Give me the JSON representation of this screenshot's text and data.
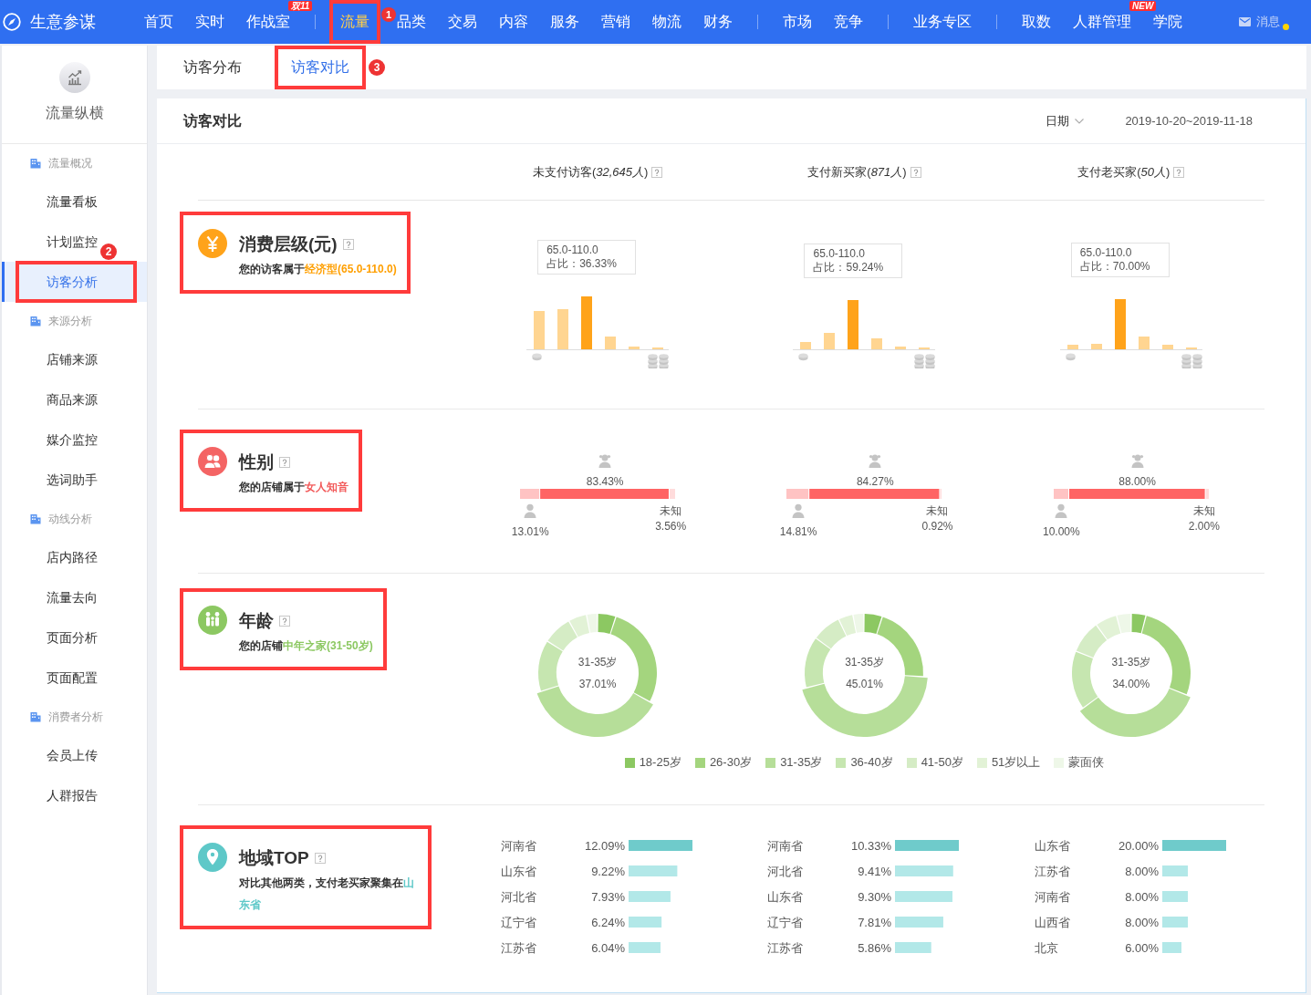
{
  "topnav": {
    "logo": "生意参谋",
    "groups": [
      {
        "items": [
          {
            "label": "首页",
            "selected": false,
            "annotated": false
          },
          {
            "label": "实时",
            "selected": false,
            "annotated": false
          },
          {
            "label": "作战室",
            "selected": false,
            "annotated": false,
            "tag": "双11"
          }
        ]
      },
      {
        "items": [
          {
            "label": "流量",
            "selected": true,
            "annotated": true,
            "badge": "1"
          },
          {
            "label": "品类",
            "selected": false,
            "annotated": false
          },
          {
            "label": "交易",
            "selected": false,
            "annotated": false
          },
          {
            "label": "内容",
            "selected": false,
            "annotated": false
          },
          {
            "label": "服务",
            "selected": false,
            "annotated": false
          },
          {
            "label": "营销",
            "selected": false,
            "annotated": false
          },
          {
            "label": "物流",
            "selected": false,
            "annotated": false
          },
          {
            "label": "财务",
            "selected": false,
            "annotated": false
          }
        ]
      },
      {
        "items": [
          {
            "label": "市场",
            "selected": false,
            "annotated": false
          },
          {
            "label": "竞争",
            "selected": false,
            "annotated": false
          }
        ]
      },
      {
        "items": [
          {
            "label": "业务专区",
            "selected": false,
            "annotated": false
          }
        ]
      },
      {
        "items": [
          {
            "label": "取数",
            "selected": false,
            "annotated": false
          },
          {
            "label": "人群管理",
            "selected": false,
            "annotated": false,
            "tag": "NEW"
          },
          {
            "label": "学院",
            "selected": false,
            "annotated": false
          }
        ]
      }
    ],
    "messages": {
      "label": "消息",
      "unread": true
    }
  },
  "sidebar": {
    "title": "流量纵横",
    "groups": [
      {
        "label": "流量概况",
        "items": [
          {
            "label": "流量看板",
            "selected": false,
            "annotated": false
          },
          {
            "label": "计划监控",
            "selected": false,
            "annotated": false
          },
          {
            "label": "访客分析",
            "selected": true,
            "annotated": true,
            "badge": "2"
          }
        ]
      },
      {
        "label": "来源分析",
        "items": [
          {
            "label": "店铺来源",
            "selected": false,
            "annotated": false
          },
          {
            "label": "商品来源",
            "selected": false,
            "annotated": false
          },
          {
            "label": "媒介监控",
            "selected": false,
            "annotated": false
          },
          {
            "label": "选词助手",
            "selected": false,
            "annotated": false
          }
        ]
      },
      {
        "label": "动线分析",
        "items": [
          {
            "label": "店内路径",
            "selected": false,
            "annotated": false
          },
          {
            "label": "流量去向",
            "selected": false,
            "annotated": false
          },
          {
            "label": "页面分析",
            "selected": false,
            "annotated": false
          },
          {
            "label": "页面配置",
            "selected": false,
            "annotated": false
          }
        ]
      },
      {
        "label": "消费者分析",
        "items": [
          {
            "label": "会员上传",
            "selected": false,
            "annotated": false
          },
          {
            "label": "人群报告",
            "selected": false,
            "annotated": false
          }
        ]
      }
    ]
  },
  "tabs": [
    {
      "label": "访客分布",
      "selected": false,
      "annotated": false
    },
    {
      "label": "访客对比",
      "selected": true,
      "annotated": true,
      "badge": "3"
    }
  ],
  "panel": {
    "title": "访客对比",
    "date_label": "日期",
    "date_range": "2019-10-20~2019-11-18",
    "columns": [
      "未支付访客(*32,645人*)",
      "支付新买家(*871人*)",
      "支付老买家(*50人*)"
    ],
    "sections": [
      {
        "kind": "spend",
        "title": "消费层级(元)",
        "summary": "您的访客属于",
        "highlight": "经济型(65.0-110.0)",
        "annotated": true,
        "charts": [
          {
            "tooltip_range": "65.0-110.0",
            "tooltip_share": "占比：36.33%"
          },
          {
            "tooltip_range": "65.0-110.0",
            "tooltip_share": "占比：59.24%"
          },
          {
            "tooltip_range": "65.0-110.0",
            "tooltip_share": "占比：70.00%"
          }
        ]
      },
      {
        "kind": "gender",
        "title": "性别",
        "summary": "您的店铺属于",
        "highlight": "女人知音",
        "annotated": true,
        "charts": [
          {
            "female_share": "83.43%",
            "male_share": "13.01%",
            "unknown_label": "未知",
            "unknown_share": "3.56%"
          },
          {
            "female_share": "84.27%",
            "male_share": "14.81%",
            "unknown_label": "未知",
            "unknown_share": "0.92%"
          },
          {
            "female_share": "88.00%",
            "male_share": "10.00%",
            "unknown_label": "未知",
            "unknown_share": "2.00%"
          }
        ]
      },
      {
        "kind": "age",
        "title": "年龄",
        "summary": "您的店铺",
        "highlight": "中年之家(31-50岁)",
        "annotated": true,
        "charts": [
          {
            "center_label": "31-35岁",
            "center_value": "37.01%"
          },
          {
            "center_label": "31-35岁",
            "center_value": "45.01%"
          },
          {
            "center_label": "31-35岁",
            "center_value": "34.00%"
          }
        ],
        "legend": [
          {
            "label": "18-25岁",
            "color": "#8cc862"
          },
          {
            "label": "26-30岁",
            "color": "#a4d57e"
          },
          {
            "label": "31-35岁",
            "color": "#b6de99"
          },
          {
            "label": "36-40岁",
            "color": "#c6e6b0"
          },
          {
            "label": "41-50岁",
            "color": "#d5ecc5"
          },
          {
            "label": "51岁以上",
            "color": "#e2f2d6"
          },
          {
            "label": "蒙面侠",
            "color": "#eef7e8"
          }
        ]
      },
      {
        "kind": "region",
        "title": "地域TOP",
        "summary": "对比其他两类，支付老买家聚集在",
        "highlight": "山东省",
        "annotated": true,
        "charts": [
          {
            "chart_data": {
              "type": "bar",
              "orientation": "horizontal",
              "categories": [
                "河南省",
                "山东省",
                "河北省",
                "辽宁省",
                "江苏省"
              ],
              "values": [
                12.09,
                9.22,
                7.93,
                6.24,
                6.04
              ],
              "value_labels": [
                "12.09%",
                "9.22%",
                "7.93%",
                "6.24%",
                "6.04%"
              ]
            }
          },
          {
            "chart_data": {
              "type": "bar",
              "orientation": "horizontal",
              "categories": [
                "河南省",
                "河北省",
                "山东省",
                "辽宁省",
                "江苏省"
              ],
              "values": [
                10.33,
                9.41,
                9.3,
                7.81,
                5.86
              ],
              "value_labels": [
                "10.33%",
                "9.41%",
                "9.30%",
                "7.81%",
                "5.86%"
              ]
            }
          },
          {
            "chart_data": {
              "type": "bar",
              "orientation": "horizontal",
              "categories": [
                "山东省",
                "江苏省",
                "河南省",
                "山西省",
                "北京"
              ],
              "values": [
                20.0,
                8.0,
                8.0,
                8.0,
                6.0
              ],
              "value_labels": [
                "20.00%",
                "8.00%",
                "8.00%",
                "8.00%",
                "6.00%"
              ]
            }
          }
        ]
      }
    ]
  }
}
